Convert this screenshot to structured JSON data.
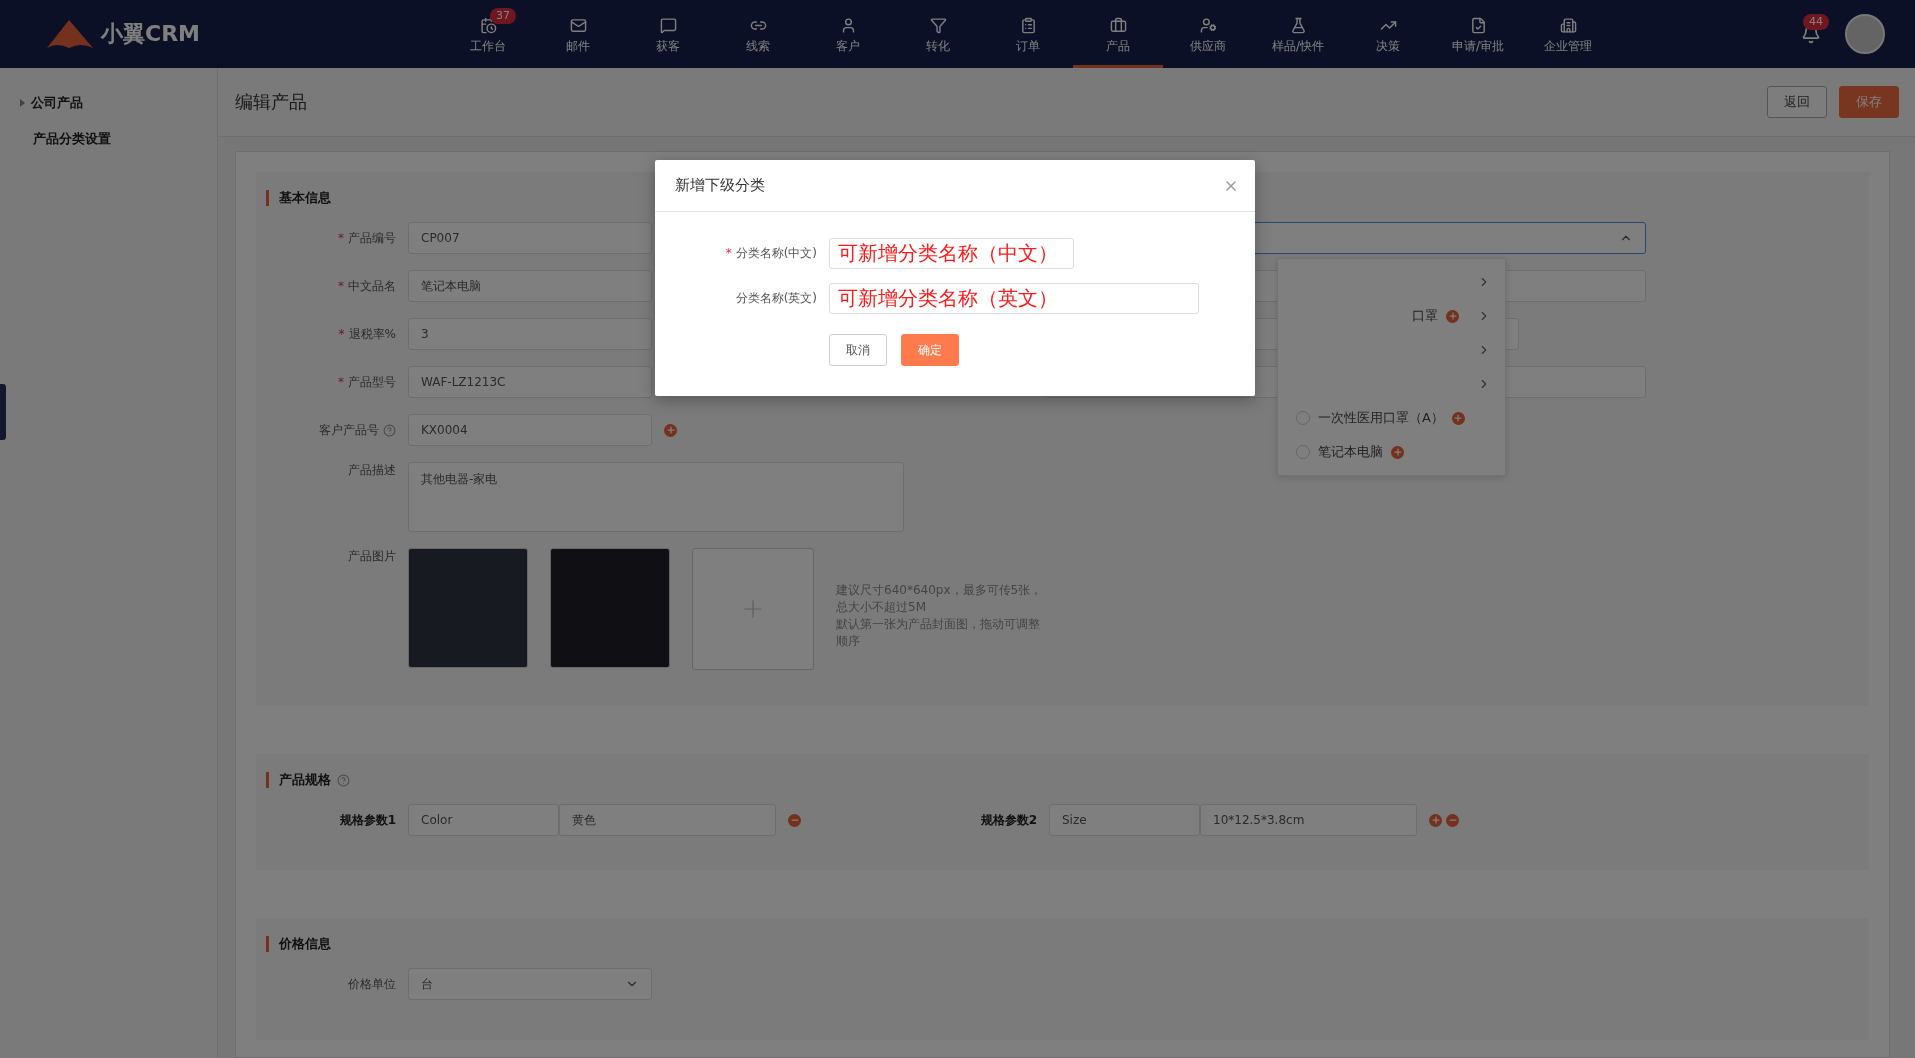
{
  "brand": {
    "name": "小翼CRM"
  },
  "nav": [
    {
      "label": "工作台",
      "badge": "37",
      "selected": false
    },
    {
      "label": "邮件",
      "selected": false
    },
    {
      "label": "获客",
      "selected": false
    },
    {
      "label": "线索",
      "selected": false
    },
    {
      "label": "客户",
      "selected": false
    },
    {
      "label": "转化",
      "selected": false
    },
    {
      "label": "订单",
      "selected": false
    },
    {
      "label": "产品",
      "selected": true
    },
    {
      "label": "供应商",
      "selected": false
    },
    {
      "label": "样品/快件",
      "selected": false
    },
    {
      "label": "决策",
      "selected": false
    },
    {
      "label": "申请/审批",
      "selected": false
    },
    {
      "label": "企业管理",
      "selected": false
    }
  ],
  "notifications": {
    "badge": "44"
  },
  "sidebar": {
    "items": [
      {
        "label": "公司产品",
        "expandable": true,
        "selected": false
      },
      {
        "label": "产品分类设置",
        "expandable": false,
        "selected": false
      }
    ]
  },
  "page": {
    "title": "编辑产品",
    "buttons": [
      {
        "label": "返回",
        "kind": "default"
      },
      {
        "label": "保存",
        "kind": "primary"
      }
    ]
  },
  "basic_info": {
    "title": "基本信息",
    "fields": [
      {
        "required_mark": "*",
        "label": "产品编号",
        "value": "CP007",
        "kind": "input"
      },
      {
        "required_mark": "*",
        "label": "中文品名",
        "value": "笔记本电脑",
        "kind": "input"
      },
      {
        "required_mark": "*",
        "label": "退税率%",
        "value": "3",
        "kind": "input"
      },
      {
        "required_mark": "*",
        "label": "产品型号",
        "value": "WAF-LZ1213C",
        "kind": "input"
      },
      {
        "label": "客户产品号",
        "help": true,
        "add": true,
        "value": "KX0004",
        "kind": "input"
      },
      {
        "label": "产品描述",
        "value": "其他电器-家电",
        "kind": "textarea"
      }
    ],
    "images": {
      "label": "产品图片",
      "hint": "建议尺寸640*640px，最多可传5张，总大小不超过5M\n默认第一张为产品封面图，拖动可调整顺序"
    },
    "category_select": {
      "expanded": true
    },
    "category_options": [
      {
        "kind": "branch",
        "add": false
      },
      {
        "kind": "branch",
        "label": "口罩",
        "add": true
      },
      {
        "kind": "branch",
        "add": false
      },
      {
        "kind": "branch",
        "add": false
      },
      {
        "kind": "leaf",
        "label": "一次性医用口罩（A）",
        "add": true,
        "checked": false
      },
      {
        "kind": "leaf",
        "label": "笔记本电脑",
        "add": true,
        "checked": false
      }
    ]
  },
  "specs": {
    "title": "产品规格",
    "params": [
      {
        "label": "规格参数1",
        "name": "Color",
        "value": "黄色",
        "add": false,
        "remove": true
      },
      {
        "label": "规格参数2",
        "name": "Size",
        "value": "10*12.5*3.8cm",
        "add": true,
        "remove": true
      }
    ]
  },
  "price": {
    "title": "价格信息",
    "unit_label": "价格单位",
    "unit_value": "台"
  },
  "dialog": {
    "title": "新增下级分类",
    "fields": [
      {
        "required_mark": "*",
        "label": "分类名称(中文)",
        "value": "可新增分类名称（中文）"
      },
      {
        "label": "分类名称(英文)",
        "value": "可新增分类名称（英文）"
      }
    ],
    "cancel": "取消",
    "confirm": "确定"
  }
}
